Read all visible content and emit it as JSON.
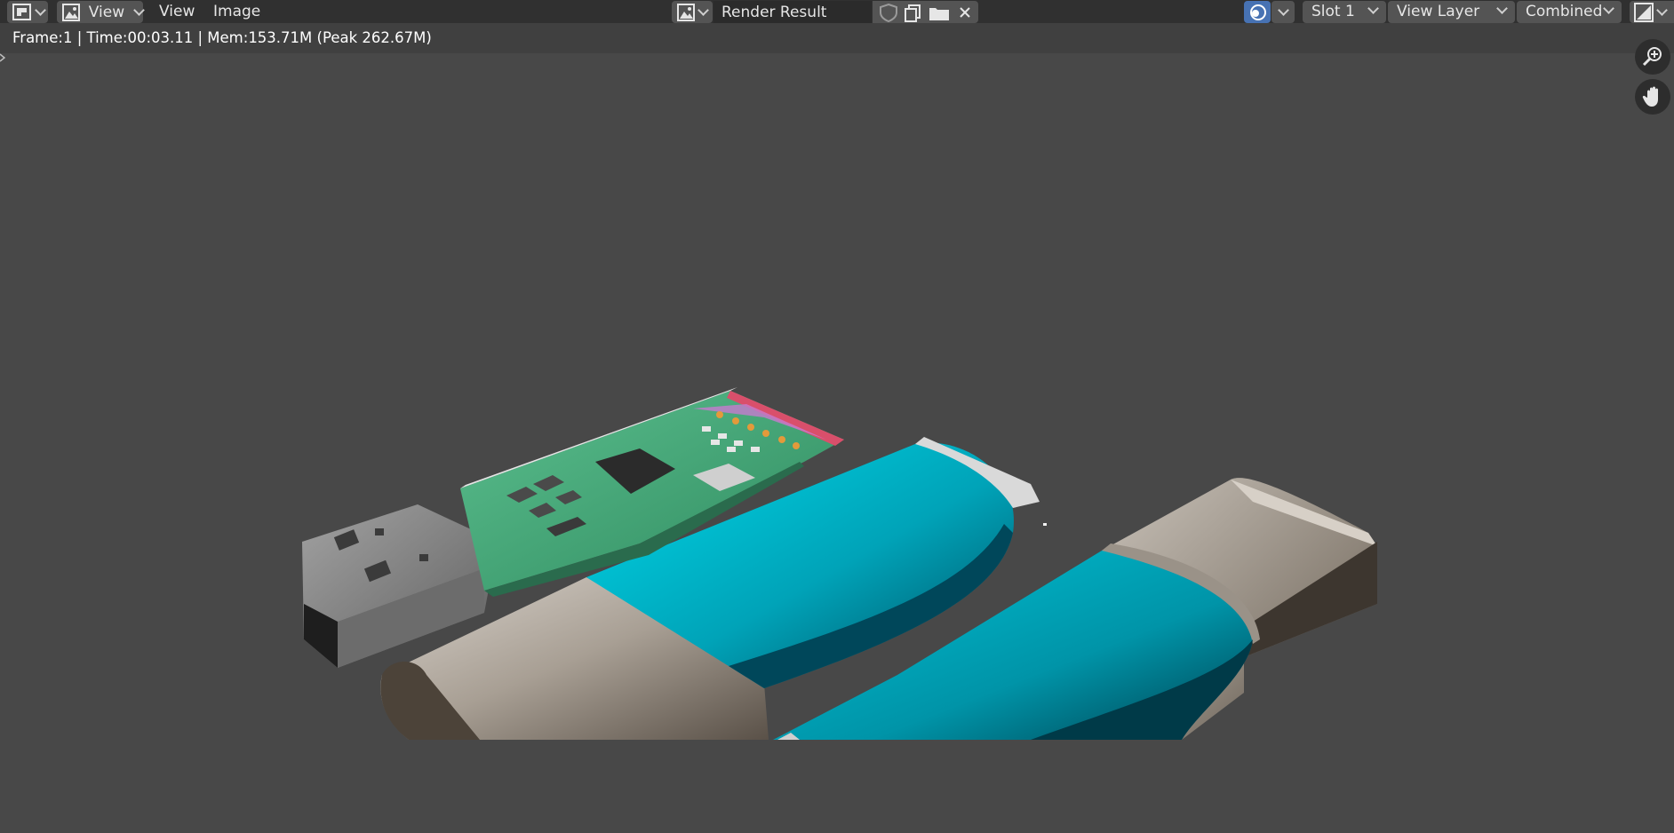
{
  "header": {
    "menus": {
      "view_dropdown": "View",
      "view": "View",
      "image": "Image"
    },
    "image_name": "Render Result",
    "slot": "Slot 1",
    "view_layer": "View Layer",
    "pass": "Combined"
  },
  "status_bar": {
    "text": "Frame:1 | Time:00:03.11 | Mem:153.71M (Peak 262.67M)"
  },
  "viewport": {
    "render_subject": "USB flash drive render",
    "gizmos": [
      "zoom-icon",
      "hand-pan-icon"
    ]
  },
  "colors": {
    "accent": "#4772b3",
    "header_bg": "#303030",
    "viewport_bg": "#484848",
    "cap_teal": "#00a8bd",
    "body_beige": "#a89f94",
    "pcb_green": "#3a9b6e"
  }
}
